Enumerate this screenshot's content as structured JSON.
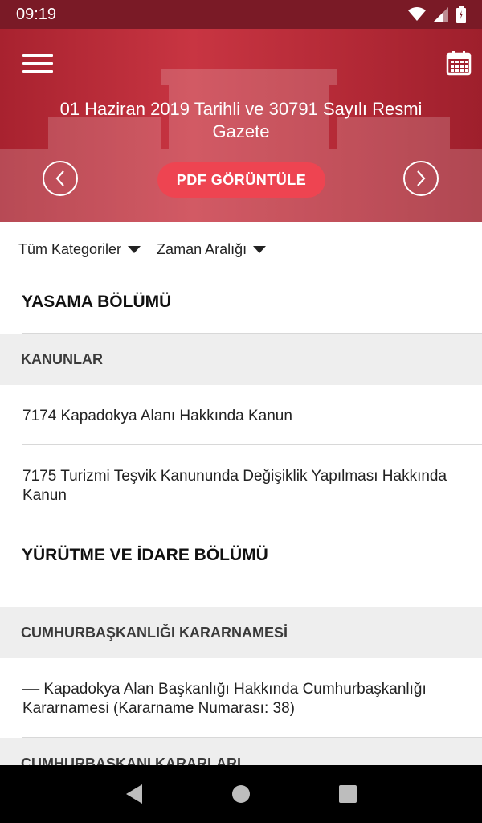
{
  "status_bar": {
    "time": "09:19"
  },
  "header": {
    "title": "01 Haziran 2019 Tarihli ve 30791 Sayılı Resmi Gazete",
    "pdf_button": "PDF GÖRÜNTÜLE",
    "accent_color": "#c83542",
    "button_color": "#ee4451"
  },
  "filters": [
    {
      "label": "Tüm Kategoriler"
    },
    {
      "label": "Zaman Aralığı"
    }
  ],
  "sections": [
    {
      "title": "YASAMA BÖLÜMÜ",
      "category": "KANUNLAR",
      "items": [
        "7174 Kapadokya Alanı Hakkında Kanun",
        "7175 Turizmi Teşvik Kanununda Değişiklik Yapılması Hakkında Kanun"
      ]
    },
    {
      "title": "YÜRÜTME VE İDARE BÖLÜMÜ",
      "category": "CUMHURBAŞKANLIĞI KARARNAMESİ",
      "items": [
        "–– Kapadokya Alan Başkanlığı Hakkında Cumhurbaşkanlığı Kararnamesi (Kararname Numarası: 38)"
      ]
    }
  ],
  "next_category": "CUMHURBAŞKANI KARARLARI",
  "icons": [
    "wifi-icon",
    "signal-icon",
    "battery-icon",
    "menu-icon",
    "calendar-icon",
    "chevron-left-icon",
    "chevron-right-icon",
    "back-icon",
    "home-icon",
    "recents-icon"
  ]
}
